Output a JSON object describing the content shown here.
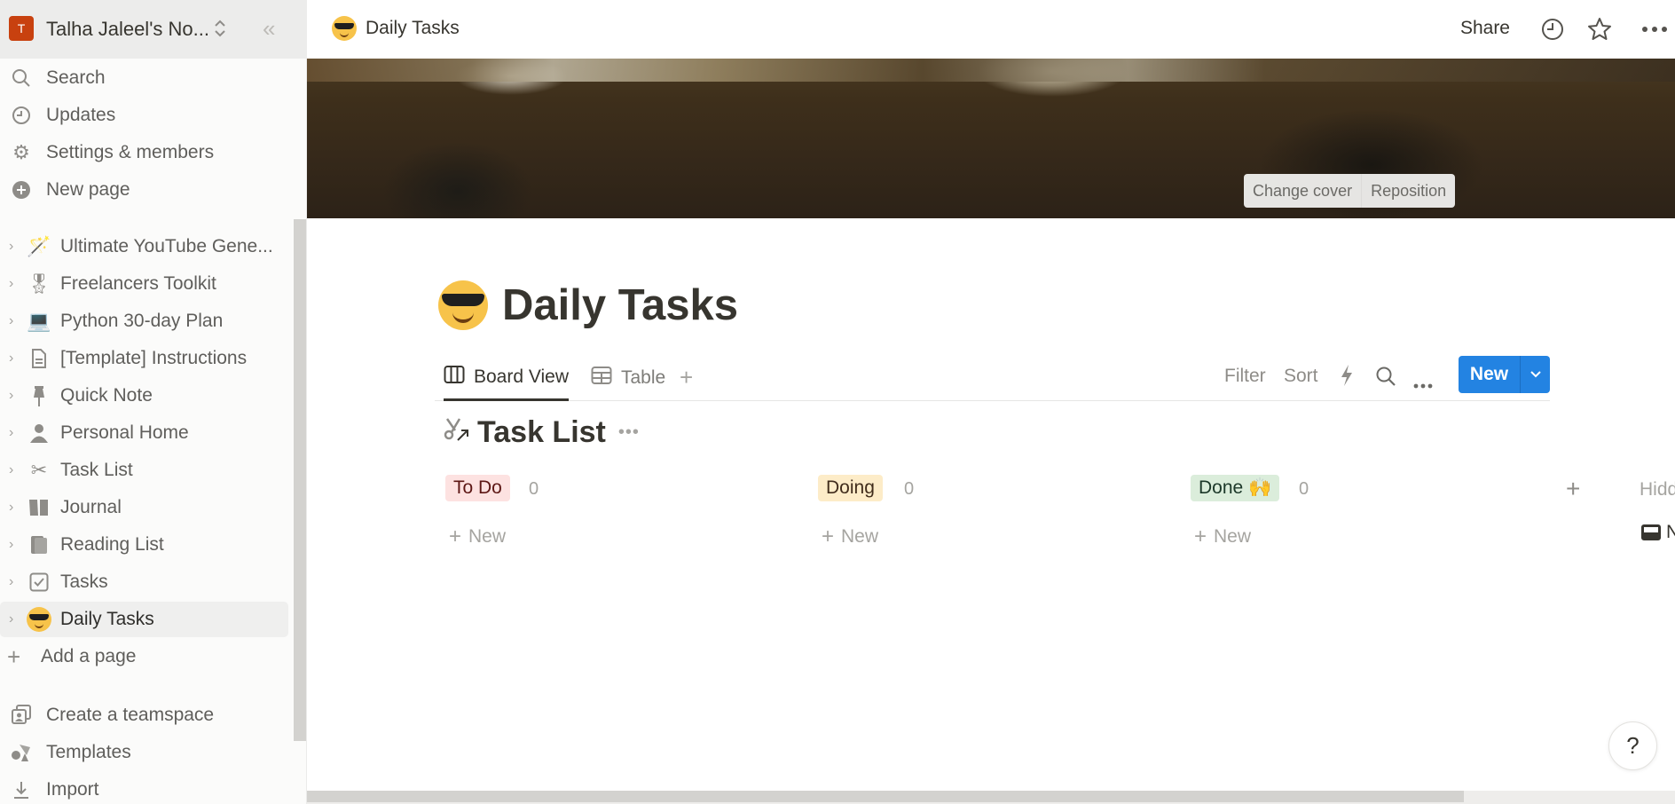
{
  "workspace": {
    "avatar_letter": "T",
    "name": "Talha Jaleel's No...",
    "avatar_color": "#c8410f"
  },
  "sidebar": {
    "nav": [
      {
        "label": "Search",
        "icon": "search-icon"
      },
      {
        "label": "Updates",
        "icon": "clock-icon"
      },
      {
        "label": "Settings & members",
        "icon": "gear-icon"
      },
      {
        "label": "New page",
        "icon": "plus-circle-icon"
      }
    ],
    "pages": [
      {
        "label": "Ultimate YouTube Gene...",
        "icon": "magic-wand-icon",
        "glyph": "🪄"
      },
      {
        "label": "Freelancers Toolkit",
        "icon": "medal-icon",
        "glyph": "🎖"
      },
      {
        "label": "Python 30-day Plan",
        "icon": "laptop-icon",
        "glyph": "💻"
      },
      {
        "label": "[Template] Instructions",
        "icon": "document-icon",
        "glyph": "🗎"
      },
      {
        "label": "Quick Note",
        "icon": "pin-icon",
        "glyph": "📌"
      },
      {
        "label": "Personal Home",
        "icon": "person-icon",
        "glyph": "👤"
      },
      {
        "label": "Task List",
        "icon": "scissors-icon",
        "glyph": "✂"
      },
      {
        "label": "Journal",
        "icon": "book-open-icon",
        "glyph": "📖"
      },
      {
        "label": "Reading List",
        "icon": "book-icon",
        "glyph": "📕"
      },
      {
        "label": "Tasks",
        "icon": "checkbox-icon",
        "glyph": "☑"
      },
      {
        "label": "Daily Tasks",
        "icon": "cool-emoji-icon",
        "glyph": "",
        "active": true
      }
    ],
    "add_page": "Add a page",
    "footer": [
      {
        "label": "Create a teamspace",
        "icon": "teamspace-icon",
        "glyph": "⧉"
      },
      {
        "label": "Templates",
        "icon": "templates-icon",
        "glyph": "◭"
      },
      {
        "label": "Import",
        "icon": "import-icon",
        "glyph": "⤓"
      }
    ]
  },
  "topbar": {
    "breadcrumb": "Daily Tasks",
    "share": "Share"
  },
  "cover": {
    "change_cover": "Change cover",
    "reposition": "Reposition"
  },
  "page": {
    "title": "Daily Tasks",
    "views": [
      {
        "label": "Board View",
        "icon": "board-icon",
        "active": true
      },
      {
        "label": "Table",
        "icon": "table-icon",
        "active": false
      }
    ],
    "toolbar": {
      "filter": "Filter",
      "sort": "Sort",
      "new": "New"
    },
    "database": {
      "title": "Task List",
      "columns": [
        {
          "label": "To Do",
          "count": "0",
          "bg": "#fde2e1",
          "fg": "#5d1715",
          "new": "New"
        },
        {
          "label": "Doing",
          "count": "0",
          "bg": "#fdecc8",
          "fg": "#402c1b",
          "new": "New"
        },
        {
          "label": "Done 🙌",
          "count": "0",
          "bg": "#dbeddb",
          "fg": "#1c3829",
          "new": "New"
        }
      ],
      "hidden_label": "Hidden groups",
      "hidden_item": "No Status"
    }
  },
  "help": "?",
  "colors": {
    "accent": "#2383e2",
    "text": "#37352f",
    "muted": "#a5a4a0"
  }
}
